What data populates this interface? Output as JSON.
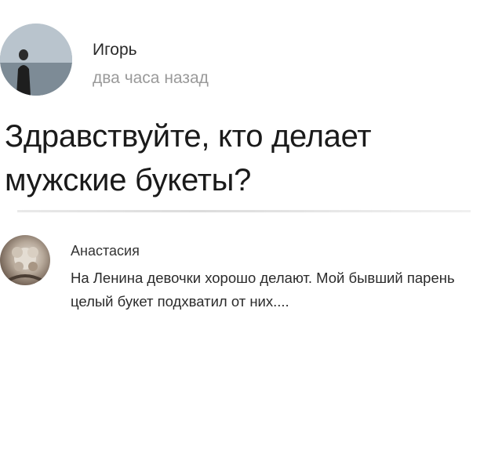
{
  "post": {
    "author_name": "Игорь",
    "time": "два часа назад",
    "text": "Здравствуйте, кто делает мужские букеты?",
    "avatar_icon": "person-avatar-icon"
  },
  "comment": {
    "author_name": "Анастасия",
    "text": "На Ленина девочки хорошо делают. Мой бывший парень целый букет подхватил от них....",
    "avatar_icon": "floral-avatar-icon"
  },
  "colors": {
    "background": "#ffffff",
    "primary_text": "#1a1a1a",
    "secondary_text": "#9a9a9a"
  }
}
